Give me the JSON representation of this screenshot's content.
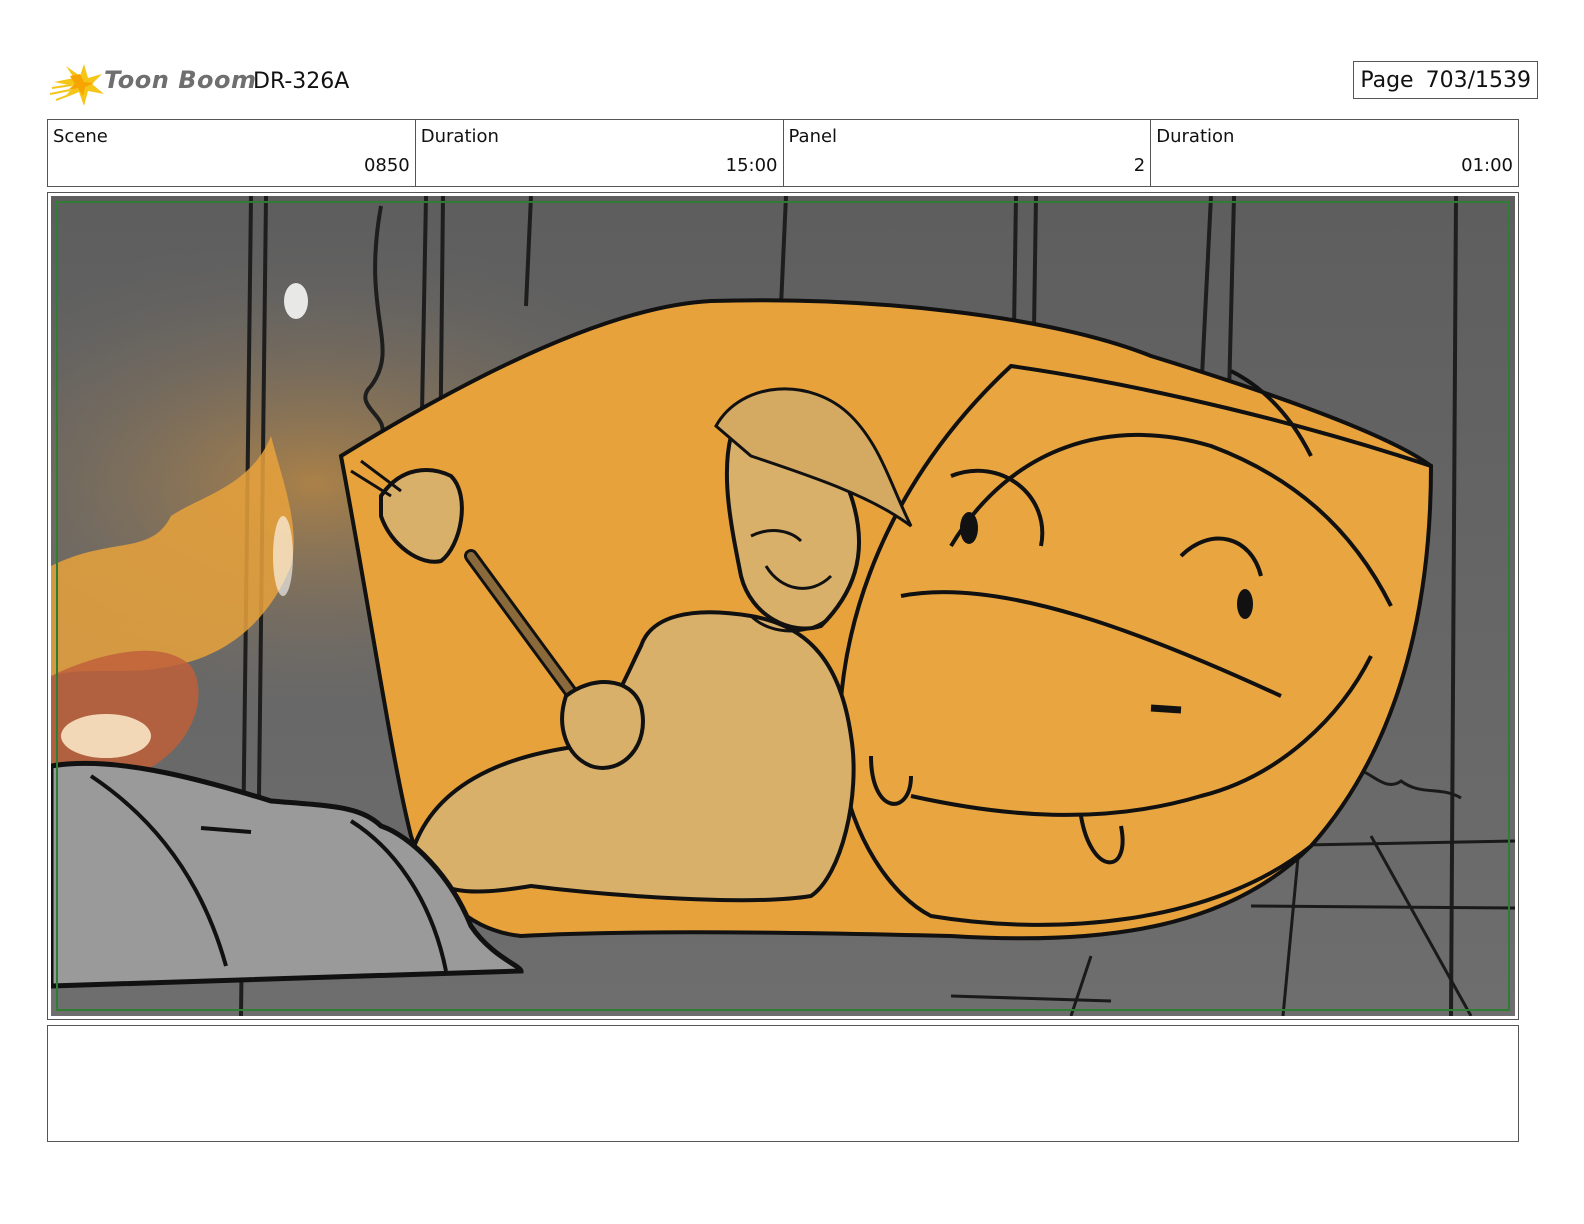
{
  "header": {
    "logo_text": "Toon Boom",
    "project_id": "DR-326A",
    "page_label": "Page",
    "page_number": "703/1539"
  },
  "info": {
    "scene_label": "Scene",
    "scene_value": "0850",
    "scene_duration_label": "Duration",
    "scene_duration_value": "15:00",
    "panel_label": "Panel",
    "panel_value": "2",
    "panel_duration_label": "Duration",
    "panel_duration_value": "01:00"
  },
  "colors": {
    "logo_star": "#f5c518",
    "safe_frame": "#2e7d32",
    "creature_orange": "#e8a23c",
    "character_tan": "#d9b06a",
    "background_gray": "#6b6b6b"
  },
  "notes": {
    "action": "",
    "dialogue": ""
  }
}
